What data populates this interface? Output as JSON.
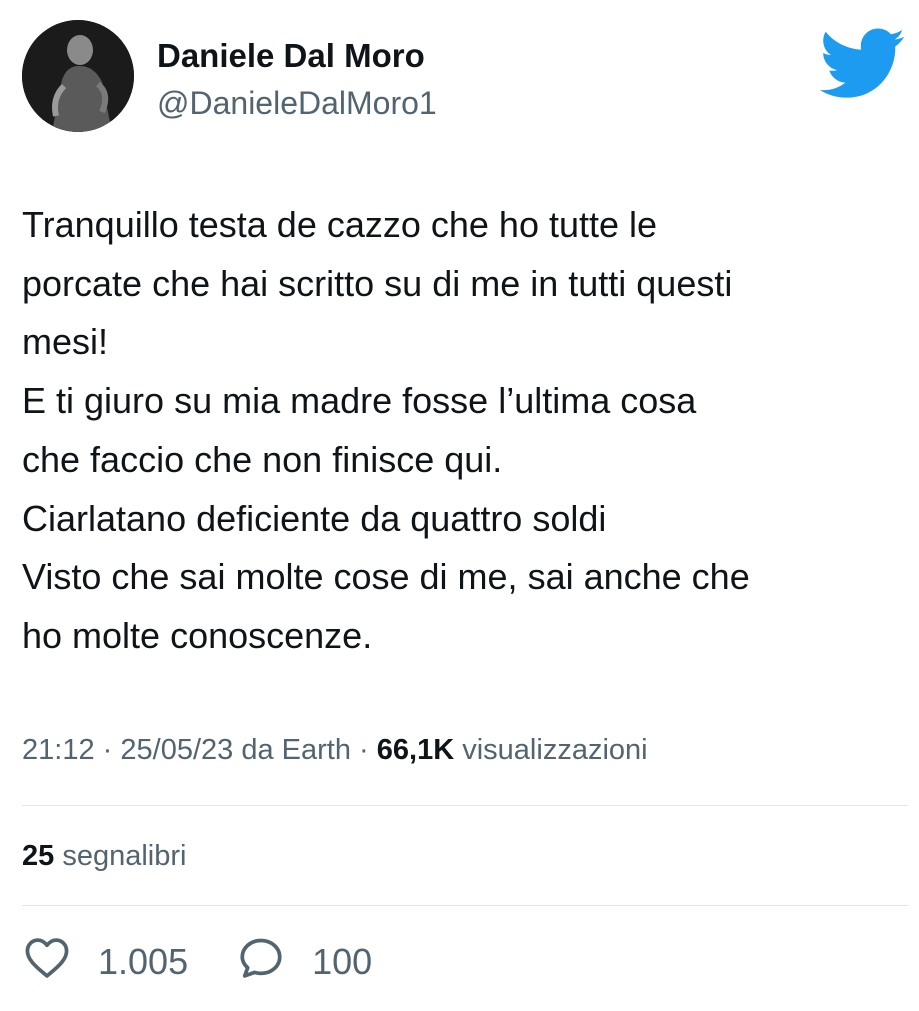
{
  "author": {
    "display_name": "Daniele Dal Moro",
    "handle": "@DanieleDalMoro1"
  },
  "icons": {
    "avatar": "user-avatar",
    "brand": "twitter-bird-icon",
    "like": "heart-icon",
    "reply": "reply-bubble-icon"
  },
  "colors": {
    "brand": "#1d9bf0",
    "text": "#0f1419",
    "secondary": "#536471"
  },
  "tweet": {
    "lines": [
      "Tranquillo testa de cazzo che ho tutte le",
      "porcate che hai scritto su di me in tutti questi",
      "mesi!",
      "E ti giuro su mia madre fosse l’ultima cosa",
      "che faccio che non finisce qui.",
      "Ciarlatano deficiente da quattro soldi",
      "Visto che sai molte cose di me, sai anche che",
      "ho molte conoscenze."
    ]
  },
  "meta": {
    "time": "21:12",
    "date": "25/05/23",
    "source_prefix": "da",
    "source": "Earth",
    "sep": "·",
    "views_count": "66,1K",
    "views_label": "visualizzazioni"
  },
  "bookmarks": {
    "count": "25",
    "label": "segnalibri"
  },
  "actions": {
    "likes": "1.005",
    "replies": "100"
  }
}
